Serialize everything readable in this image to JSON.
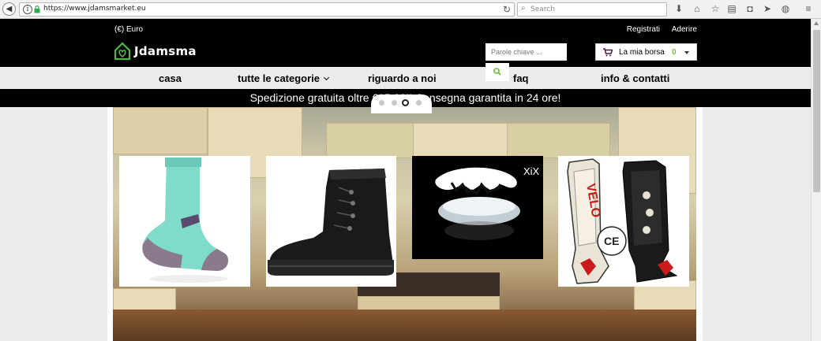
{
  "browser": {
    "url": "https://www.jdamsmarket.eu",
    "search_placeholder": "Search"
  },
  "header": {
    "currency": "(€) Euro",
    "register_label": "Registrati",
    "join_label": "Aderire",
    "logo_text": "Jdamsma",
    "keyword_placeholder": "Parole chiave ...",
    "cart_label": "La mia borsa",
    "cart_count": "0"
  },
  "nav": {
    "items": [
      {
        "label": "casa"
      },
      {
        "label": "tutte le categorie"
      },
      {
        "label": "riguardo a noi"
      },
      {
        "label": "faq"
      },
      {
        "label": "info & contatti"
      }
    ]
  },
  "promo": {
    "text": "Spedizione gratuita oltre €15,00!! Consegna garantita in 24 ore!"
  },
  "slider": {
    "dots": 4,
    "active_dot": 3
  },
  "products": [
    {
      "name": "running-socks"
    },
    {
      "name": "winter-boot"
    },
    {
      "name": "mouthguard",
      "brand": "XiX"
    },
    {
      "name": "shin-guards",
      "brand": "VELO"
    }
  ],
  "colors": {
    "header_bg": "#000000",
    "accent_green": "#7ac143",
    "nav_bg": "#ececec"
  }
}
